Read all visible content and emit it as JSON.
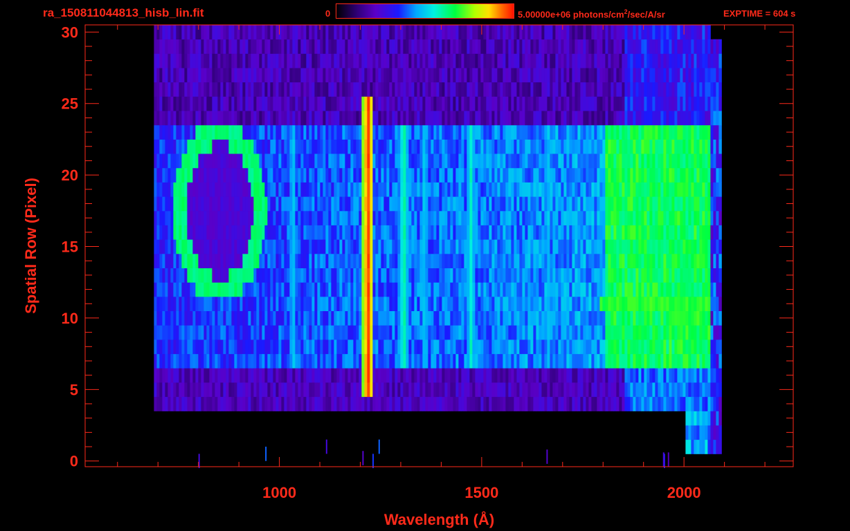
{
  "header": {
    "filename": "ra_150811044813_hisb_lin.fit",
    "colorbar_min": "0",
    "colorbar_max_main": "5.00000e+06 photons/cm",
    "colorbar_max_sup": "2",
    "colorbar_max_tail": "/sec/A/sr",
    "exptime": "EXPTIME = 604 s"
  },
  "chart_data": {
    "type": "heatmap",
    "title": "ra_150811044813_hisb_lin.fit",
    "xlabel": "Wavelength (Å)",
    "ylabel": "Spatial Row (Pixel)",
    "xlim": [
      520,
      2270
    ],
    "ylim": [
      -0.4,
      30.5
    ],
    "x_ticks": [
      1000,
      1500,
      2000
    ],
    "y_ticks": [
      0,
      5,
      10,
      15,
      20,
      25,
      30
    ],
    "x_minor_step": 100,
    "y_minor_step": 1,
    "colorbar": {
      "min": 0,
      "max": 5000000,
      "units": "photons/cm^2/sec/A/sr"
    },
    "data_extent": {
      "x": [
        690,
        2065
      ],
      "y": [
        4,
        30
      ]
    },
    "features": [
      {
        "type": "emission_line",
        "wavelength": 1216,
        "rows": [
          5,
          25
        ],
        "intensity": 0.95
      },
      {
        "type": "emission_line",
        "wavelength": 1304,
        "rows": [
          7,
          23
        ],
        "intensity": 0.6
      },
      {
        "type": "emission_line",
        "wavelength": 1030,
        "rows": [
          7,
          23
        ],
        "intensity": 0.5
      },
      {
        "type": "emission_line",
        "wavelength": 1356,
        "rows": [
          7,
          23
        ],
        "intensity": 0.5
      },
      {
        "type": "emission_line",
        "wavelength": 1470,
        "rows": [
          7,
          23
        ],
        "intensity": 0.55
      },
      {
        "type": "emission_line",
        "wavelength": 1660,
        "rows": [
          7,
          23
        ],
        "intensity": 0.48
      },
      {
        "type": "continuum_band",
        "wavelength": [
          1800,
          2065
        ],
        "rows": [
          7,
          23
        ],
        "intensity": 0.68
      },
      {
        "type": "ring",
        "center_wavelength": 850,
        "center_row": 17.5,
        "half_width": 100,
        "half_height": 5.5,
        "intensity": 0.6
      },
      {
        "type": "edge_line",
        "wavelength": 2065,
        "rows": [
          1,
          30
        ],
        "intensity": 0.9
      }
    ]
  }
}
